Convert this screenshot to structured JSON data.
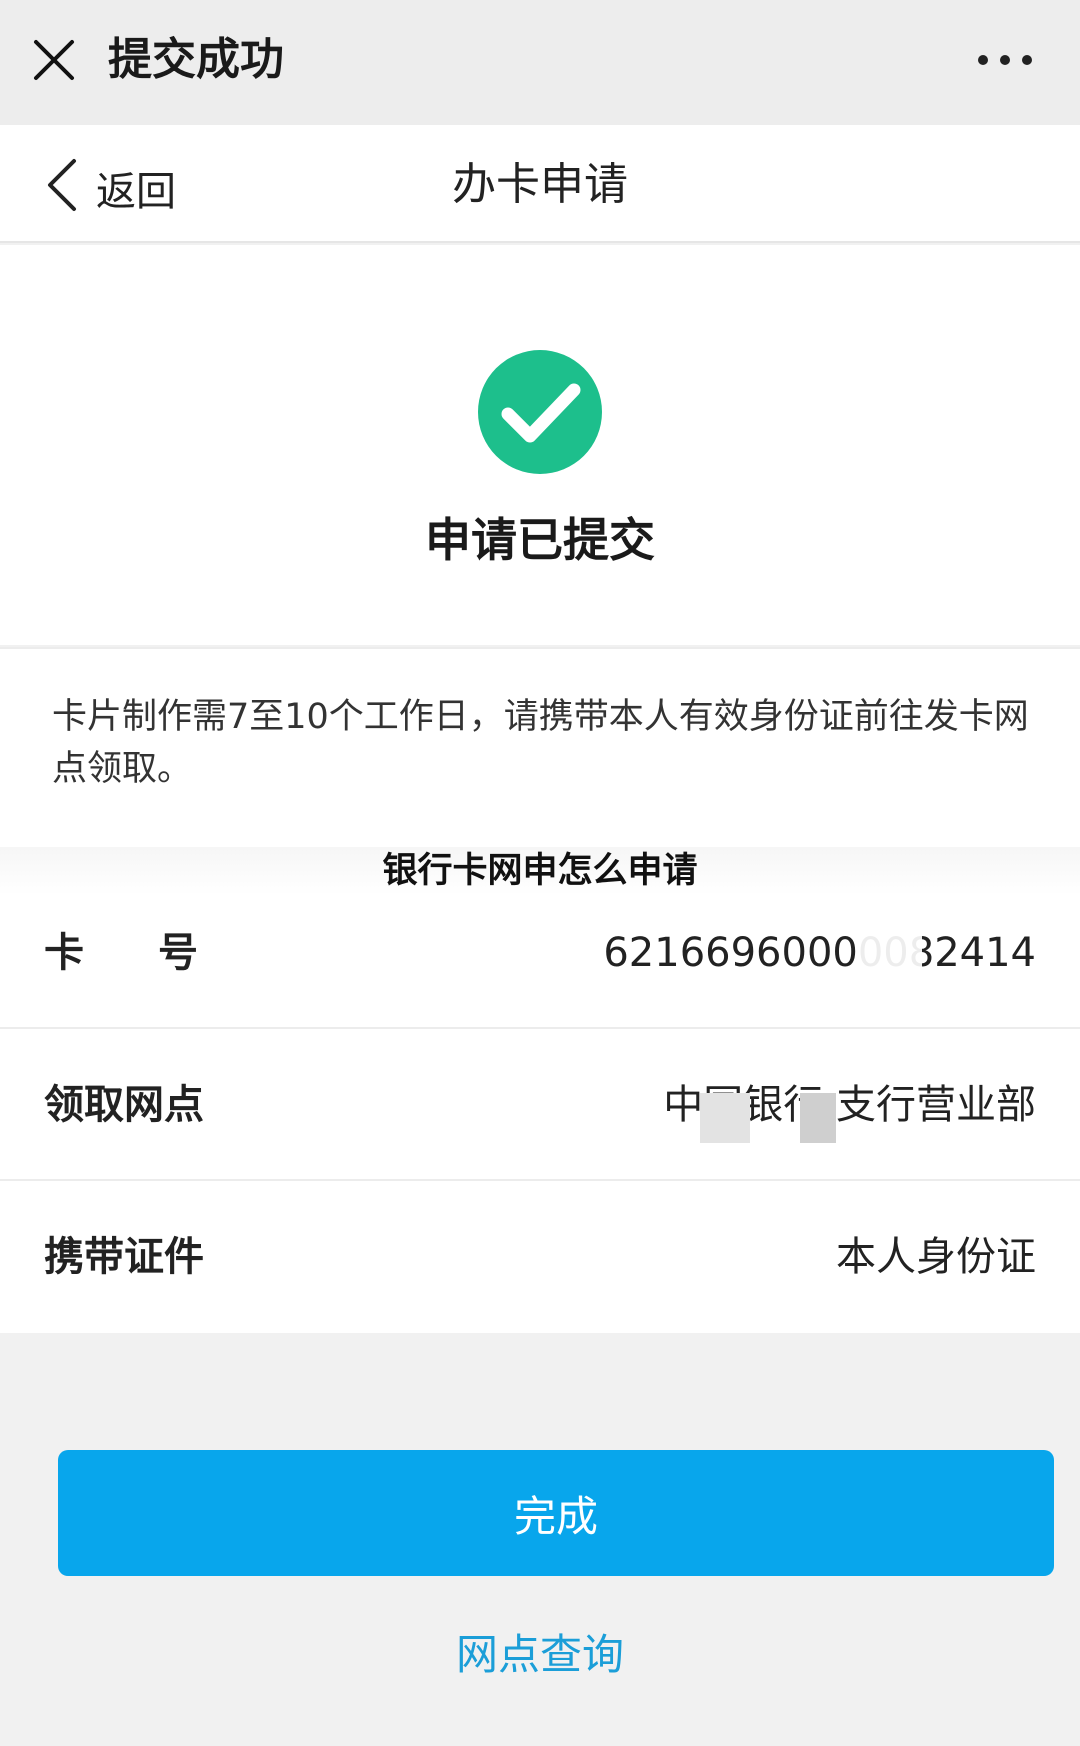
{
  "app_bar": {
    "title": "提交成功",
    "close_icon": "close-icon",
    "more_icon": "more-horizontal-icon"
  },
  "nav_bar": {
    "back_label": "返回",
    "title": "办卡申请"
  },
  "success": {
    "message": "申请已提交",
    "icon": "check-circle-icon",
    "icon_color": "#1dbf8c"
  },
  "notice": {
    "text": "卡片制作需7至10个工作日，请携带本人有效身份证前往发卡网点领取。"
  },
  "watermark": {
    "text": "银行卡网申怎么申请"
  },
  "details": [
    {
      "label": "卡号",
      "value": "62166960000082414"
    },
    {
      "label": "领取网点",
      "value": "中国银行        支行营业部"
    },
    {
      "label": "携带证件",
      "value": "本人身份证"
    }
  ],
  "actions": {
    "done_label": "完成",
    "done_color": "#08a6ec",
    "query_link": "网点查询"
  }
}
